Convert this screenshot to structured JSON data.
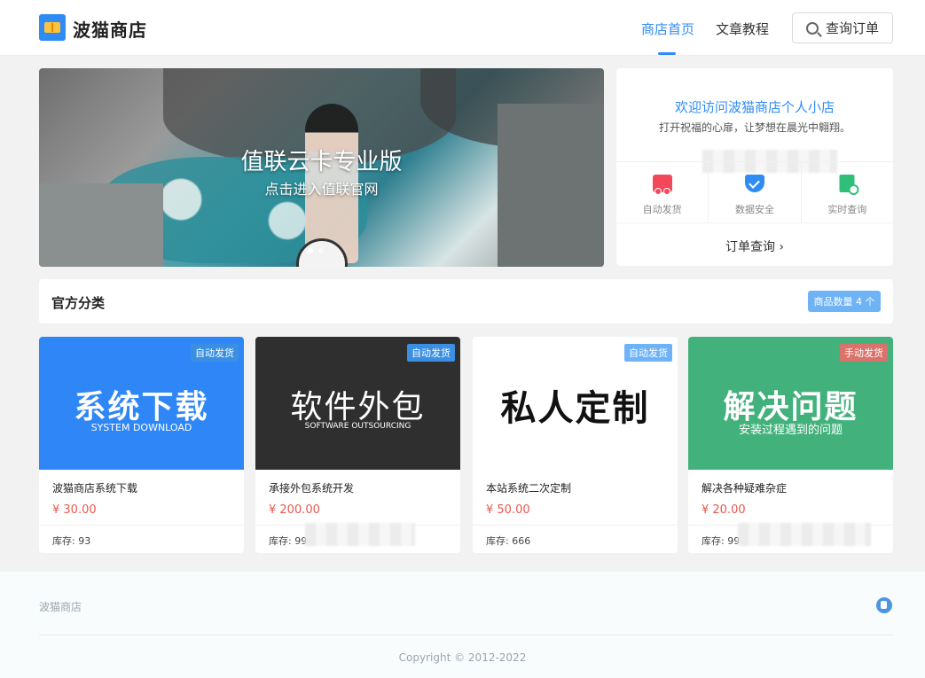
{
  "header": {
    "brand": "波猫商店",
    "nav": [
      {
        "label": "商店首页",
        "active": true
      },
      {
        "label": "文章教程",
        "active": false
      }
    ],
    "query_button": "查询订单"
  },
  "banner": {
    "title": "值联云卡专业版",
    "subtitle": "点击进入值联官网"
  },
  "welcome": {
    "title": "欢迎访问波猫商店个人小店",
    "description": "打开祝福的心扉，让梦想在晨光中翱翔。",
    "features": [
      {
        "label": "自动发货",
        "icon": "truck-icon",
        "color": "#f2485a"
      },
      {
        "label": "数据安全",
        "icon": "shield-icon",
        "color": "#2f8cf5"
      },
      {
        "label": "实时查询",
        "icon": "document-search-icon",
        "color": "#2fbf7a"
      }
    ],
    "order_link": "订单查询 ›"
  },
  "category": {
    "title": "官方分类",
    "count_badge": "商品数量 4 个"
  },
  "products": [
    {
      "tag": "自动发货",
      "image_title": "系统下载",
      "image_subtitle": "SYSTEM DOWNLOAD",
      "image_bg": "#2f86f6",
      "name": "波猫商店系统下载",
      "price": "¥ 30.00",
      "stock": "库存: 93"
    },
    {
      "tag": "自动发货",
      "image_title": "软件外包",
      "image_subtitle": "SOFTWARE OUTSOURCING",
      "image_bg": "#2f2f2f",
      "name": "承接外包系统开发",
      "price": "¥ 200.00",
      "stock": "库存: 99"
    },
    {
      "tag": "自动发货",
      "image_title": "私人定制",
      "image_subtitle": "",
      "image_bg": "#ffffff",
      "name": "本站系统二次定制",
      "price": "¥ 50.00",
      "stock": "库存: 666"
    },
    {
      "tag": "手动发货",
      "image_title": "解决问题",
      "image_subtitle": "安装过程遇到的问题",
      "image_bg": "#43b17c",
      "name": "解决各种疑难杂症",
      "price": "¥ 20.00",
      "stock": "库存: 999"
    }
  ],
  "footer": {
    "brand": "波猫商店",
    "copyright": "Copyright © 2012-2022"
  },
  "colors": {
    "accent": "#2f8cf5",
    "price": "#e8584f",
    "tag_auto": "#3b8fe3",
    "tag_manual": "#d9736b"
  }
}
